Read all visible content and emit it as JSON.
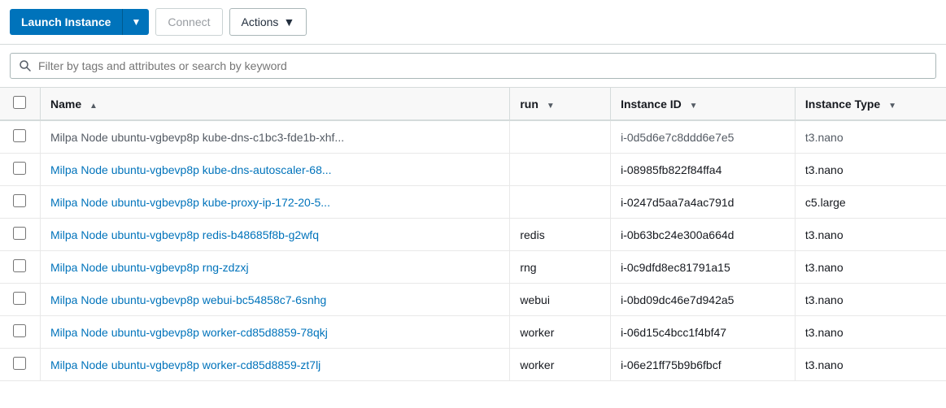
{
  "toolbar": {
    "launch_label": "Launch Instance",
    "launch_arrow": "▼",
    "connect_label": "Connect",
    "actions_label": "Actions",
    "actions_arrow": "▼"
  },
  "search": {
    "placeholder": "Filter by tags and attributes or search by keyword"
  },
  "table": {
    "columns": [
      {
        "id": "name",
        "label": "Name",
        "sort": "▲"
      },
      {
        "id": "run",
        "label": "run",
        "sort": "▼"
      },
      {
        "id": "instance_id",
        "label": "Instance ID",
        "sort": "▼"
      },
      {
        "id": "instance_type",
        "label": "Instance Type",
        "sort": "▼"
      }
    ],
    "partial_row": {
      "name": "Milpa Node ubuntu-vgbevp8p kube-dns-c1bc3-fde1b-xhf...",
      "run": "",
      "instance_id": "i-0d5d6e7c8ddd6e7e5",
      "instance_type": "t3.nano"
    },
    "rows": [
      {
        "name": "Milpa Node ubuntu-vgbevp8p kube-dns-autoscaler-68...",
        "run": "",
        "instance_id": "i-08985fb822f84ffa4",
        "instance_type": "t3.nano"
      },
      {
        "name": "Milpa Node ubuntu-vgbevp8p kube-proxy-ip-172-20-5...",
        "run": "",
        "instance_id": "i-0247d5aa7a4ac791d",
        "instance_type": "c5.large"
      },
      {
        "name": "Milpa Node ubuntu-vgbevp8p redis-b48685f8b-g2wfq",
        "run": "redis",
        "instance_id": "i-0b63bc24e300a664d",
        "instance_type": "t3.nano"
      },
      {
        "name": "Milpa Node ubuntu-vgbevp8p rng-zdzxj",
        "run": "rng",
        "instance_id": "i-0c9dfd8ec81791a15",
        "instance_type": "t3.nano"
      },
      {
        "name": "Milpa Node ubuntu-vgbevp8p webui-bc54858c7-6snhg",
        "run": "webui",
        "instance_id": "i-0bd09dc46e7d942a5",
        "instance_type": "t3.nano"
      },
      {
        "name": "Milpa Node ubuntu-vgbevp8p worker-cd85d8859-78qkj",
        "run": "worker",
        "instance_id": "i-06d15c4bcc1f4bf47",
        "instance_type": "t3.nano"
      },
      {
        "name": "Milpa Node ubuntu-vgbevp8p worker-cd85d8859-zt7lj",
        "run": "worker",
        "instance_id": "i-06e21ff75b9b6fbcf",
        "instance_type": "t3.nano"
      }
    ]
  }
}
